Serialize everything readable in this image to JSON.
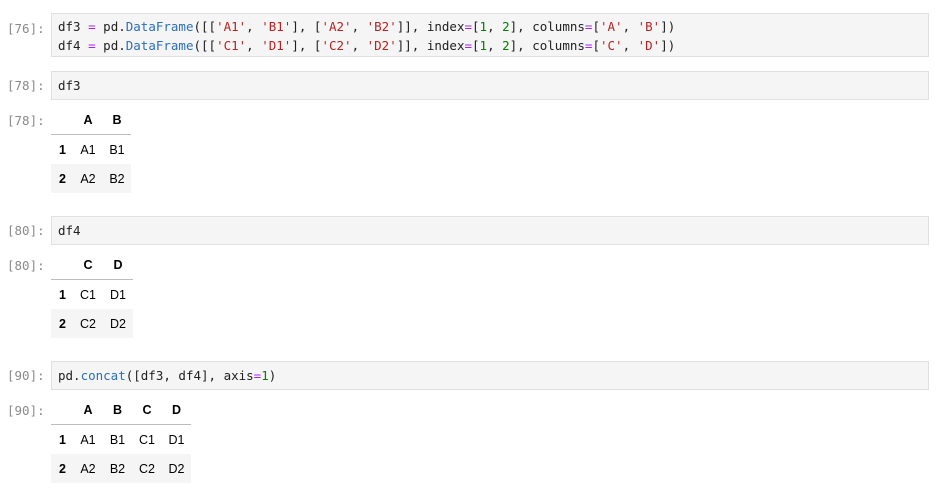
{
  "cells": [
    {
      "prompt": "[76]:",
      "lines": [
        {
          "a": "df3 ",
          "b": "=",
          "c": " pd.",
          "d": "DataFrame",
          "e": "([[",
          "f": "'A1'",
          "g": ", ",
          "h": "'B1'",
          "i": "], [",
          "j": "'A2'",
          "k": ", ",
          "l": "'B2'",
          "m": "]], index",
          "n": "=",
          "o": "[",
          "p": "1",
          "q": ", ",
          "r": "2",
          "s": "], columns",
          "t": "=",
          "u": "[",
          "v": "'A'",
          "w": ", ",
          "x": "'B'",
          "y": "])"
        },
        {
          "a": "df4 ",
          "b": "=",
          "c": " pd.",
          "d": "DataFrame",
          "e": "([[",
          "f": "'C1'",
          "g": ", ",
          "h": "'D1'",
          "i": "], [",
          "j": "'C2'",
          "k": ", ",
          "l": "'D2'",
          "m": "]], index",
          "n": "=",
          "o": "[",
          "p": "1",
          "q": ", ",
          "r": "2",
          "s": "], columns",
          "t": "=",
          "u": "[",
          "v": "'C'",
          "w": ", ",
          "x": "'D'",
          "y": "])"
        }
      ]
    },
    {
      "prompt": "[78]:",
      "code": "df3"
    },
    {
      "prompt": "[78]:",
      "table": {
        "columns": [
          "A",
          "B"
        ],
        "rows": [
          {
            "index": "1",
            "values": [
              "A1",
              "B1"
            ]
          },
          {
            "index": "2",
            "values": [
              "A2",
              "B2"
            ]
          }
        ]
      }
    },
    {
      "prompt": "[80]:",
      "code": "df4"
    },
    {
      "prompt": "[80]:",
      "table": {
        "columns": [
          "C",
          "D"
        ],
        "rows": [
          {
            "index": "1",
            "values": [
              "C1",
              "D1"
            ]
          },
          {
            "index": "2",
            "values": [
              "C2",
              "D2"
            ]
          }
        ]
      }
    },
    {
      "prompt": "[90]:",
      "concat": {
        "a": "pd.",
        "b": "concat",
        "c": "([df3, df4], axis",
        "d": "=",
        "e": "1",
        "f": ")"
      }
    },
    {
      "prompt": "[90]:",
      "table": {
        "columns": [
          "A",
          "B",
          "C",
          "D"
        ],
        "rows": [
          {
            "index": "1",
            "values": [
              "A1",
              "B1",
              "C1",
              "D1"
            ]
          },
          {
            "index": "2",
            "values": [
              "A2",
              "B2",
              "C2",
              "D2"
            ]
          }
        ]
      }
    }
  ]
}
